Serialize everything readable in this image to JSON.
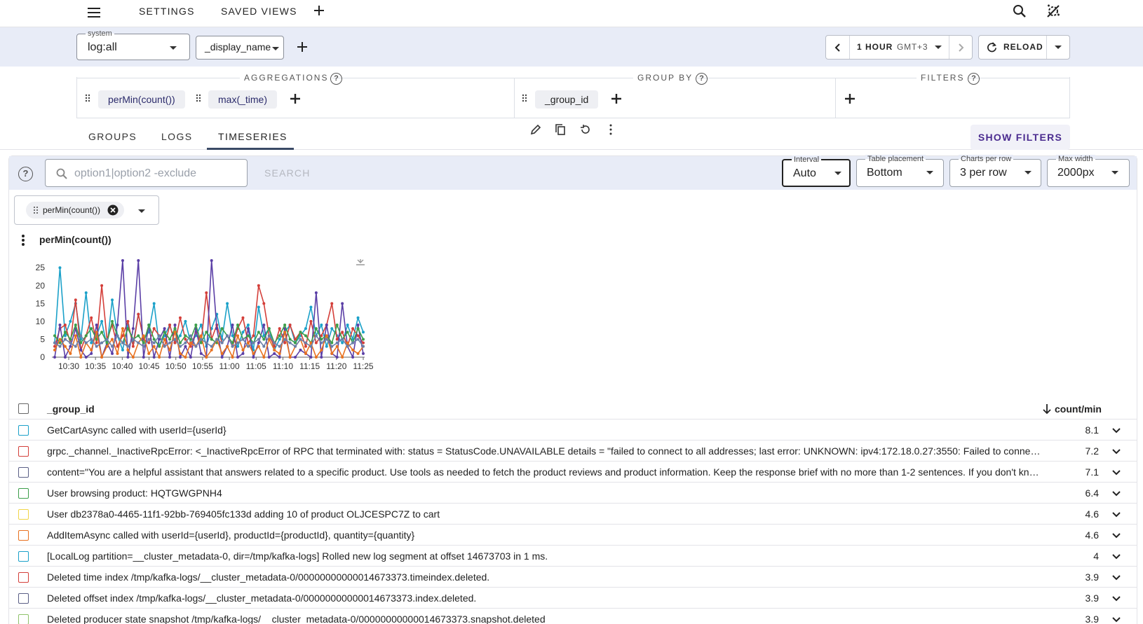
{
  "topbar": {
    "settings": "SETTINGS",
    "saved_views": "SAVED VIEWS"
  },
  "query": {
    "system_label": "system",
    "system_value": "log:all",
    "display_field": "_display_name",
    "time_range": "1 HOUR",
    "timezone": "GMT+3",
    "reload": "RELOAD"
  },
  "aggregations": {
    "label": "AGGREGATIONS",
    "items": [
      "perMin(count())",
      "max(_time)"
    ]
  },
  "group_by": {
    "label": "GROUP BY",
    "items": [
      "_group_id"
    ]
  },
  "filters": {
    "label": "FILTERS"
  },
  "tabs": [
    "GROUPS",
    "LOGS",
    "TIMESERIES"
  ],
  "active_tab": "TIMESERIES",
  "show_filters": "SHOW FILTERS",
  "toolbar": {
    "search_placeholder": "option1|option2 -exclude",
    "search_button": "SEARCH",
    "interval_label": "Interval",
    "interval_value": "Auto",
    "placement_label": "Table placement",
    "placement_value": "Bottom",
    "charts_label": "Charts per row",
    "charts_value": "3 per row",
    "width_label": "Max width",
    "width_value": "2000px"
  },
  "metric_chip": "perMin(count())",
  "chart_data": {
    "type": "line",
    "title": "perMin(count())",
    "x": [
      "10:30",
      "10:35",
      "10:40",
      "10:45",
      "10:50",
      "10:55",
      "11:00",
      "11:05",
      "11:10",
      "11:15",
      "11:20",
      "11:25"
    ],
    "ylim": [
      0,
      27
    ],
    "yticks": [
      0,
      5,
      10,
      15,
      20,
      25
    ],
    "grid": false,
    "series": [
      {
        "color": "#1ba1c9",
        "values": [
          4,
          25,
          6,
          10,
          15,
          5,
          18,
          4,
          6,
          10,
          3,
          16,
          6,
          2,
          9,
          4,
          12,
          5,
          7,
          15,
          3,
          6,
          9,
          4,
          6,
          10,
          4,
          6,
          9,
          3,
          8,
          12,
          5,
          15,
          6,
          3,
          7,
          9,
          2,
          14,
          6,
          8,
          2,
          5,
          7,
          9,
          4,
          6,
          8,
          14,
          6,
          9,
          3,
          8,
          6,
          4,
          9,
          5,
          11,
          7
        ]
      },
      {
        "color": "#d43f3a",
        "values": [
          3,
          8,
          9,
          4,
          16,
          2,
          6,
          11,
          4,
          20,
          5,
          9,
          3,
          6,
          10,
          3,
          12,
          5,
          4,
          8,
          6,
          3,
          9,
          4,
          11,
          5,
          3,
          7,
          4,
          18,
          5,
          9,
          4,
          6,
          3,
          8,
          11,
          4,
          6,
          20,
          15,
          6,
          3,
          8,
          4,
          9,
          5,
          7,
          3,
          10,
          4,
          6,
          9,
          15,
          5,
          7,
          3,
          8,
          6,
          4
        ]
      },
      {
        "color": "#5b3fa6",
        "values": [
          0,
          9,
          0,
          3,
          8,
          2,
          0,
          1,
          9,
          0,
          4,
          1,
          9,
          27,
          0,
          8,
          27,
          0,
          9,
          0,
          5,
          8,
          0,
          9,
          0,
          3,
          0,
          8,
          1,
          0,
          27,
          8,
          0,
          3,
          9,
          0,
          1,
          8,
          0,
          4,
          9,
          0,
          1,
          0,
          8,
          0,
          0,
          2,
          1,
          0,
          18,
          0,
          9,
          1,
          0,
          15,
          3,
          0,
          9,
          1
        ]
      },
      {
        "color": "#3c9e4a",
        "values": [
          6,
          4,
          7,
          5,
          9,
          4,
          6,
          8,
          5,
          7,
          4,
          10,
          6,
          4,
          8,
          5,
          6,
          4,
          9,
          5,
          3,
          7,
          5,
          8,
          4,
          6,
          5,
          9,
          4,
          7,
          5,
          4,
          8,
          6,
          4,
          9,
          5,
          6,
          4,
          7,
          5,
          8,
          4,
          6,
          9,
          5,
          4,
          7,
          6,
          4,
          8,
          5,
          6,
          4,
          9,
          5,
          7,
          4,
          8,
          5
        ]
      },
      {
        "color": "#e8711f",
        "values": [
          2,
          5,
          3,
          1,
          6,
          0,
          4,
          2,
          7,
          0,
          3,
          5,
          1,
          8,
          2,
          0,
          4,
          6,
          1,
          3,
          0,
          5,
          2,
          7,
          1,
          0,
          4,
          3,
          6,
          0,
          2,
          5,
          1,
          3,
          0,
          6,
          2,
          4,
          1,
          3,
          0,
          5,
          2,
          1,
          7,
          0,
          3,
          5,
          1,
          4,
          0,
          2,
          6,
          1,
          3,
          0,
          4,
          2,
          1,
          3
        ]
      },
      {
        "color": "#6a7fa8",
        "values": [
          4,
          3,
          5,
          4,
          3,
          6,
          4,
          5,
          3,
          4,
          5,
          3,
          6,
          4,
          3,
          5,
          4,
          3,
          5,
          4,
          6,
          3,
          4,
          5,
          3,
          4,
          6,
          3,
          5,
          4,
          3,
          5,
          4,
          6,
          3,
          4,
          5,
          3,
          4,
          5,
          3,
          6,
          4,
          3,
          5,
          4,
          3,
          5,
          4,
          3,
          6,
          4,
          5,
          3,
          4,
          5,
          3,
          4,
          5,
          3
        ]
      }
    ]
  },
  "table": {
    "col_group": "_group_id",
    "col_count": "count/min",
    "rows": [
      {
        "color": "#1ba1c9",
        "msg": "GetCartAsync called with userId={userId}",
        "count": "8.1"
      },
      {
        "color": "#d43f3a",
        "msg": "grpc._channel._InactiveRpcError: <_InactiveRpcError of RPC that terminated with: status = StatusCode.UNAVAILABLE details = \"failed to connect to all addresses; last error: UNKNOWN: ipv4:172.18.0.27:3550: Failed to connect to remote host: Connection refused\"",
        "count": "7.2"
      },
      {
        "color": "#5b5f86",
        "msg": "content=\"You are a helpful assistant that answers related to a specific product. Use tools as needed to fetch the product reviews and product information. Keep the response brief with no more than 1-2 sentences. If you don't know the answer, say so.\"",
        "count": "7.1"
      },
      {
        "color": "#3c9e4a",
        "msg": "User browsing product: HQTGWGPNH4",
        "count": "6.4"
      },
      {
        "color": "#f0d548",
        "msg": "User db2378a0-4465-11f1-92bb-769405fc133d adding 10 of product OLJCESPC7Z to cart",
        "count": "4.6"
      },
      {
        "color": "#e8711f",
        "msg": "AddItemAsync called with userId={userId}, productId={productId}, quantity={quantity}",
        "count": "4.6"
      },
      {
        "color": "#1ba1c9",
        "msg": "[LocalLog partition=__cluster_metadata-0, dir=/tmp/kafka-logs] Rolled new log segment at offset 14673703 in 1 ms.",
        "count": "4"
      },
      {
        "color": "#d43f3a",
        "msg": "Deleted time index /tmp/kafka-logs/__cluster_metadata-0/00000000000014673373.timeindex.deleted.",
        "count": "3.9"
      },
      {
        "color": "#5b5f86",
        "msg": "Deleted offset index /tmp/kafka-logs/__cluster_metadata-0/00000000000014673373.index.deleted.",
        "count": "3.9"
      },
      {
        "color": "#8fc26a",
        "msg": "Deleted producer state snapshot /tmp/kafka-logs/__cluster_metadata-0/00000000000014673373.snapshot.deleted",
        "count": "3.9"
      }
    ]
  }
}
